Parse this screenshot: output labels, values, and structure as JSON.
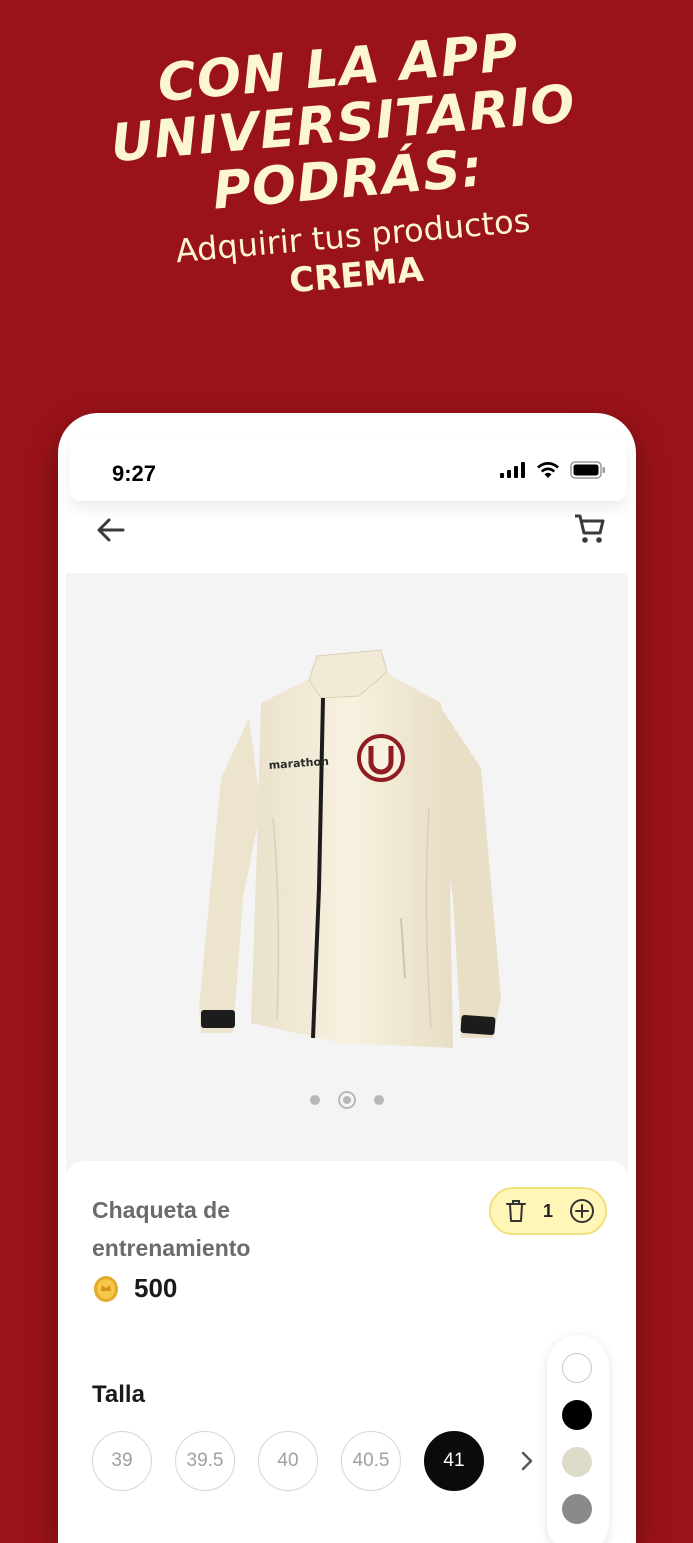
{
  "hero": {
    "line1": "CON LA APP",
    "line2": "UNIVERSITARIO",
    "line3": "PODRÁS:",
    "subtitle": "Adquirir tus productos",
    "highlight": "CREMA"
  },
  "status_bar": {
    "time": "9:27",
    "icons": [
      "signal-icon",
      "wifi-icon",
      "battery-icon"
    ]
  },
  "app_bar": {
    "icons": [
      "back-arrow-icon",
      "cart-icon"
    ]
  },
  "product": {
    "brand_text": "marathon",
    "image_carousel": {
      "total": 3,
      "active_index": 1
    },
    "name": "Chaqueta de entrenamiento",
    "quantity": "1",
    "price": "500",
    "price_icon": "coin-icon"
  },
  "size_section": {
    "label": "Talla",
    "options": [
      "39",
      "39.5",
      "40",
      "40.5",
      "41"
    ],
    "selected": "41"
  },
  "color_options": [
    "#ffffff",
    "#000000",
    "#dedbc9",
    "#8a8a8a"
  ],
  "colors": {
    "background": "#9a1319",
    "headline": "#fdf6d2",
    "quantity_pill": "#fff6b8"
  }
}
